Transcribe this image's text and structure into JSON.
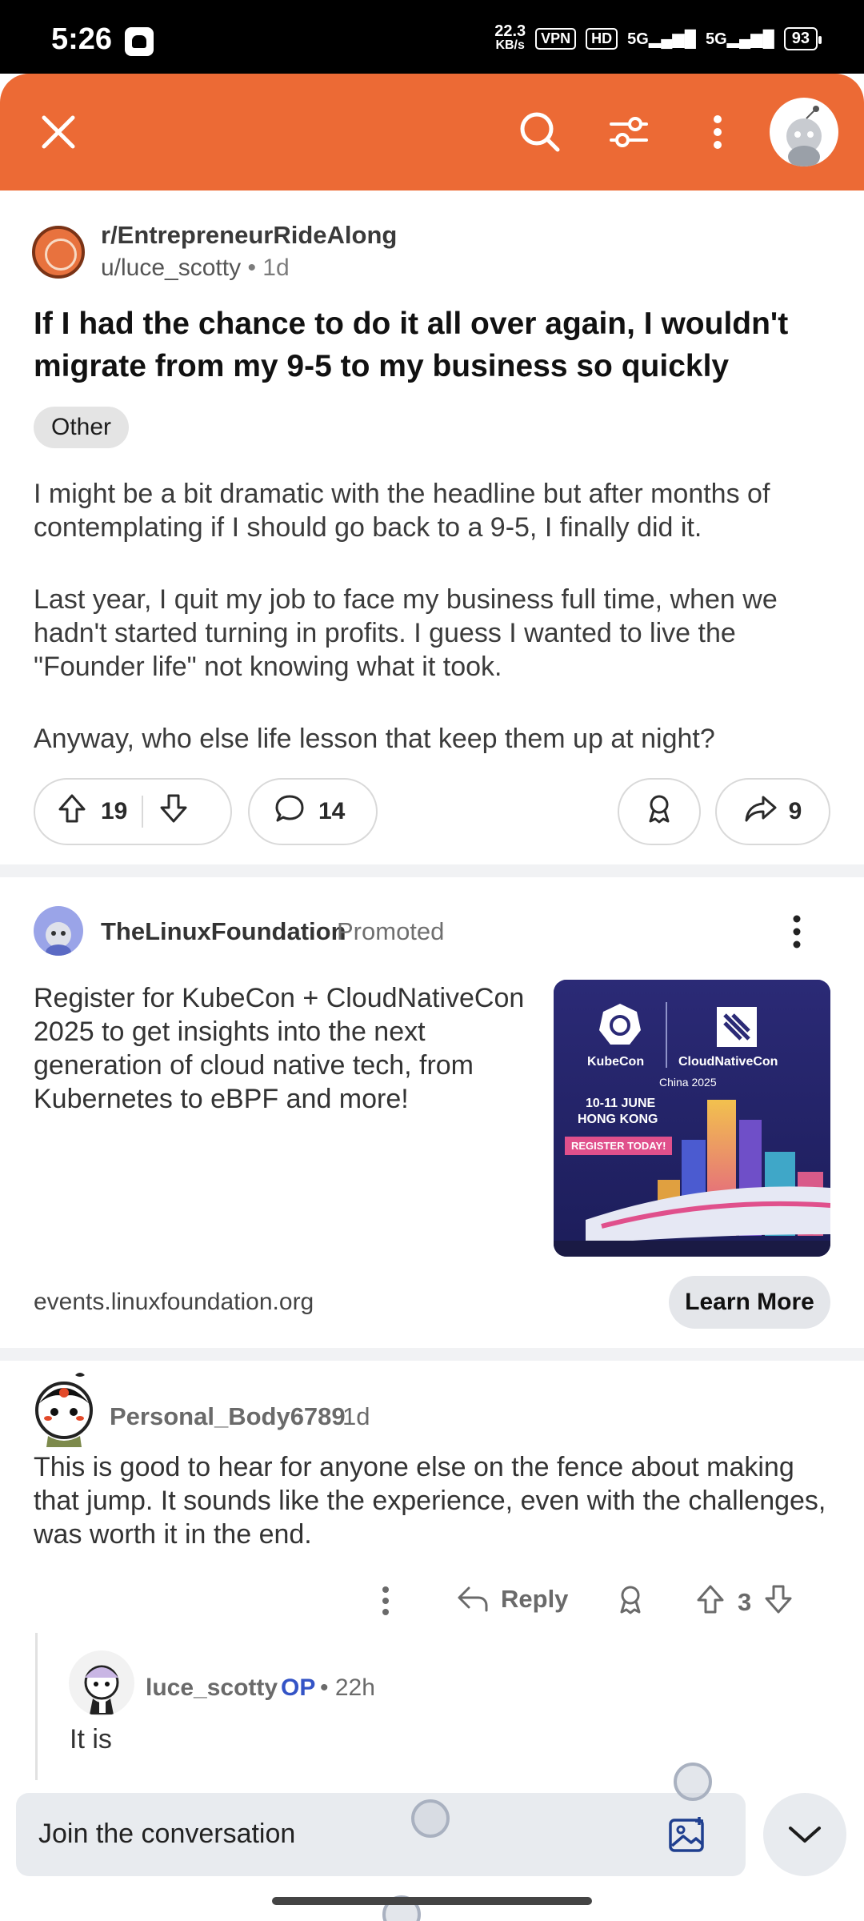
{
  "status_bar": {
    "time": "5:26",
    "speed_value": "22.3",
    "speed_unit": "KB/s",
    "vpn": "VPN",
    "hd": "HD",
    "signal1": "5G",
    "signal2": "5G",
    "battery": "93"
  },
  "header": {
    "close_icon": "close-icon",
    "search_icon": "search-icon",
    "filter_icon": "filter-icon",
    "more_icon": "more-vertical-icon",
    "avatar": "user-avatar",
    "bg_color": "#ec6a35"
  },
  "post": {
    "subreddit": "r/EntrepreneurRideAlong",
    "author": "u/luce_scotty",
    "dot": "•",
    "age": "1d",
    "title": "If I had the chance to do it all over again, I wouldn't migrate from my 9-5 to my business so quickly",
    "flair": "Other",
    "body": [
      "I might be a bit dramatic with the headline but after months of contemplating if I should go back to a 9-5, I finally did it.",
      "Last year, I quit my job to face my business full time, when we hadn't started turning in profits. I guess I wanted to live the \"Founder life\" not knowing what it took.",
      "Anyway, who else life lesson that keep them up at night?"
    ],
    "upvotes": "19",
    "comments": "14",
    "shares": "9"
  },
  "ad": {
    "advertiser": "TheLinuxFoundation",
    "promoted_label": "Promoted",
    "text": "Register for KubeCon + CloudNativeCon 2025 to get insights into the next generation of cloud native tech, from Kubernetes to eBPF and more!",
    "image": {
      "brand1": "KubeCon",
      "brand2": "CloudNativeCon",
      "location": "China 2025",
      "date": "10-11 JUNE",
      "city": "HONG KONG",
      "cta": "REGISTER TODAY!"
    },
    "url": "events.linuxfoundation.org",
    "cta_label": "Learn More"
  },
  "comment": {
    "author": "Personal_Body6789",
    "age": "1d",
    "body": "This is good to hear for anyone else on the fence about making that jump. It sounds like the experience, even with the challenges, was worth it in the end.",
    "reply_label": "Reply",
    "votes": "3"
  },
  "reply": {
    "author": "luce_scotty",
    "op_badge": "OP",
    "dot": "•",
    "age": "22h",
    "body": "It is"
  },
  "composer": {
    "placeholder": "Join the conversation"
  }
}
